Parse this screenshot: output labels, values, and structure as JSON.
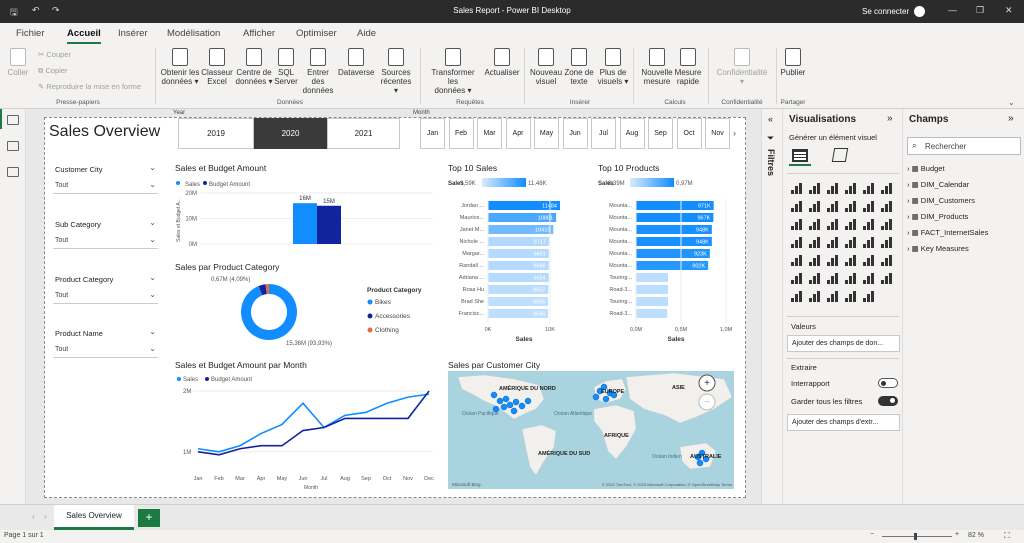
{
  "window": {
    "title": "Sales Report - Power BI Desktop",
    "signin": "Se connecter"
  },
  "menu": [
    "Fichier",
    "Accueil",
    "Insérer",
    "Modélisation",
    "Afficher",
    "Optimiser",
    "Aide"
  ],
  "ribbon": {
    "paste": "Coller",
    "cut": "Couper",
    "copy": "Copier",
    "format_painter": "Reproduire la mise en forme",
    "clipboard_group": "Presse-papiers",
    "data_buttons": [
      [
        "Obtenir les",
        "données ▾"
      ],
      [
        "Classeur",
        "Excel"
      ],
      [
        "Centre de",
        "données ▾"
      ],
      [
        "SQL",
        "Server"
      ],
      [
        "Entrer des",
        "données"
      ],
      [
        "Dataverse",
        ""
      ],
      [
        "Sources",
        "récentes ▾"
      ]
    ],
    "data_group": "Données",
    "query_buttons": [
      [
        "Transformer les",
        "données ▾"
      ],
      [
        "Actualiser",
        ""
      ]
    ],
    "query_group": "Requêtes",
    "insert_buttons": [
      [
        "Nouveau",
        "visuel"
      ],
      [
        "Zone de",
        "texte"
      ],
      [
        "Plus de",
        "visuels ▾"
      ]
    ],
    "insert_group": "Insérer",
    "calc_buttons": [
      [
        "Nouvelle",
        "mesure"
      ],
      [
        "Mesure",
        "rapide"
      ]
    ],
    "calc_group": "Calculs",
    "conf_button": [
      "Confidentialité",
      "▾"
    ],
    "conf_group": "Confidentialité",
    "publish": "Publier",
    "share_group": "Partager"
  },
  "report": {
    "title": "Sales Overview",
    "year_label": "Year",
    "years": [
      "2019",
      "2020",
      "2021"
    ],
    "month_label": "Month",
    "months": [
      "Jan",
      "Feb",
      "Mar",
      "Apr",
      "May",
      "Jun",
      "Jul",
      "Aug",
      "Sep",
      "Oct",
      "Nov"
    ],
    "slicers": [
      {
        "label": "Customer City",
        "value": "Tout"
      },
      {
        "label": "Sub Category",
        "value": "Tout"
      },
      {
        "label": "Product Category",
        "value": "Tout"
      },
      {
        "label": "Product Name",
        "value": "Tout"
      }
    ]
  },
  "chart_data": [
    {
      "type": "bar",
      "title": "Sales et Budget Amount",
      "legend": [
        "Sales",
        "Budget Amount"
      ],
      "ylabel": "Sales et Budget A...",
      "yticks": [
        "0M",
        "10M",
        "20M"
      ],
      "ylim": [
        0,
        20
      ],
      "series": [
        {
          "name": "Sales",
          "values": [
            16
          ],
          "label": "16M",
          "color": "#118DFF"
        },
        {
          "name": "Budget Amount",
          "values": [
            15
          ],
          "label": "15M",
          "color": "#12239E"
        }
      ]
    },
    {
      "type": "pie",
      "title": "Sales par Product Category",
      "legend_title": "Product Category",
      "slices": [
        {
          "name": "Bikes",
          "value": 15.36,
          "label": "15,36M (93,93%)",
          "color": "#118DFF"
        },
        {
          "name": "Accessories",
          "value": 0.67,
          "label": "0,67M (4,09%)",
          "color": "#12239E"
        },
        {
          "name": "Clothing",
          "value": 0.32,
          "color": "#E66C37"
        }
      ]
    },
    {
      "type": "bar",
      "title": "Top 10 Sales",
      "xlabel": "Sales",
      "legend_title": "Sales",
      "legend_min": "9,59K",
      "legend_max": "11,48K",
      "xticks": [
        "0K",
        "10K"
      ],
      "categories": [
        "Jordan ...",
        "Maurice...",
        "Janet M...",
        "Nichole ...",
        "Margar...",
        "Randall ...",
        "Adriana ...",
        "Rosa Hu",
        "Brad She",
        "Francisc..."
      ],
      "values": [
        11484,
        10861,
        10418,
        9717,
        9691,
        9688,
        9684,
        9637,
        9595,
        9586
      ]
    },
    {
      "type": "bar",
      "title": "Top 10 Products",
      "xlabel": "Sales",
      "legend_title": "Sales",
      "legend_min": "0,39M",
      "legend_max": "0,97M",
      "xticks": [
        "0,0M",
        "0,5M",
        "1,0M"
      ],
      "categories": [
        "Mounta...",
        "Mounta...",
        "Mounta...",
        "Mounta...",
        "Mounta...",
        "Mounta...",
        "Touring...",
        "Road-3...",
        "Touring...",
        "Road-3..."
      ],
      "values": [
        971,
        967,
        948,
        948,
        923,
        902,
        400,
        400,
        400,
        390
      ],
      "value_labels": [
        "971K",
        "967K",
        "948K",
        "948K",
        "923K",
        "902K",
        "",
        "",
        "",
        ""
      ]
    },
    {
      "type": "line",
      "title": "Sales et Budget Amount par Month",
      "legend": [
        "Sales",
        "Budget Amount"
      ],
      "xlabel": "Month",
      "yticks": [
        "1M",
        "2M"
      ],
      "categories": [
        "Jan",
        "Feb",
        "Mar",
        "Apr",
        "May",
        "Jun",
        "Jul",
        "Aug",
        "Sep",
        "Oct",
        "Nov",
        "Dec"
      ],
      "series": [
        {
          "name": "Sales",
          "values": [
            1.05,
            1.0,
            1.1,
            1.3,
            1.45,
            1.8,
            1.4,
            1.6,
            1.65,
            1.8,
            1.9,
            1.95
          ],
          "color": "#118DFF"
        },
        {
          "name": "Budget Amount",
          "values": [
            1.0,
            0.95,
            1.05,
            1.1,
            1.1,
            1.35,
            1.4,
            1.55,
            1.55,
            1.55,
            1.55,
            2.0
          ],
          "color": "#12239E"
        }
      ]
    }
  ],
  "map": {
    "title": "Sales par Customer City",
    "labels": [
      "AMÉRIQUE DU NORD",
      "EUROPE",
      "ASIE",
      "Océan Pacifique",
      "Océan Atlantique",
      "AFRIQUE",
      "AMÉRIQUE DU SUD",
      "Océan Indien",
      "AUSTRALIE"
    ],
    "footer": "© 2022 TomTom, © 2023 Microsoft Corporation, © OpenStreetMap  Terms",
    "brand": "Microsoft Bing"
  },
  "filters": {
    "label": "Filtres"
  },
  "viz": {
    "title": "Visualisations",
    "build": "Générer un élément visuel",
    "values": "Valeurs",
    "values_well": "Ajouter des champs de don...",
    "drill": "Extraire",
    "cross": "Interrapport",
    "keep": "Garder tous les filtres",
    "drill_well": "Ajouter des champs d'extr..."
  },
  "fields": {
    "title": "Champs",
    "search": "Rechercher",
    "tables": [
      "Budget",
      "DIM_Calendar",
      "DIM_Customers",
      "DIM_Products",
      "FACT_InternetSales",
      "Key Measures"
    ]
  },
  "tabs": {
    "page": "Sales Overview",
    "add": "+"
  },
  "status": {
    "page": "Page 1 sur 1",
    "zoom": "82 %"
  }
}
